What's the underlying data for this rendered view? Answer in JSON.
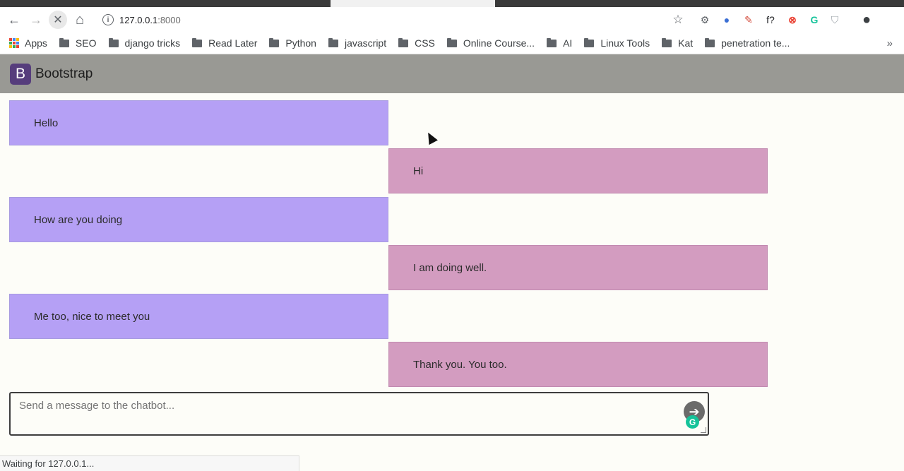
{
  "browser": {
    "url_host": "127.0.0.1",
    "url_port": ":8000",
    "nav": {
      "back": "←",
      "forward": "→",
      "stop": "✕",
      "home": "⌂"
    },
    "info_glyph": "i",
    "star_glyph": "☆",
    "extensions": [
      {
        "name": "puzzle-extension-icon",
        "glyph": "⚙",
        "color": "#5f6368"
      },
      {
        "name": "globe-extension-icon",
        "glyph": "●",
        "color": "#3b6fd4"
      },
      {
        "name": "eyedropper-extension-icon",
        "glyph": "✎",
        "color": "#d34a3a"
      },
      {
        "name": "function-extension-icon",
        "glyph": "f?",
        "color": "#202124"
      },
      {
        "name": "block-extension-icon",
        "glyph": "⊗",
        "color": "#ea4335"
      },
      {
        "name": "grammarly-extension-icon",
        "glyph": "G",
        "color": "#15c39a"
      },
      {
        "name": "shield-extension-icon",
        "glyph": "⛉",
        "color": "#9aa0a6"
      },
      {
        "name": "profile-avatar-icon",
        "glyph": "●",
        "color": "#3c4043"
      }
    ],
    "bookmarks": {
      "apps_label": "Apps",
      "folders": [
        "SEO",
        "django tricks",
        "Read Later",
        "Python",
        "javascript",
        "CSS",
        "Online Course...",
        "AI",
        "Linux Tools",
        "Kat",
        "penetration te..."
      ],
      "more_glyph": "»"
    },
    "status": "Waiting for 127.0.0.1..."
  },
  "app": {
    "brand_letter": "B",
    "brand_name": "Bootstrap",
    "colors": {
      "navbar": "#999994",
      "bot_bubble": "#b5a0f5",
      "user_bubble": "#d39cc0",
      "brand": "#563d7c"
    }
  },
  "chat": {
    "messages": [
      {
        "sender": "bot",
        "text": "Hello"
      },
      {
        "sender": "user",
        "text": "Hi"
      },
      {
        "sender": "bot",
        "text": "How are you doing"
      },
      {
        "sender": "user",
        "text": "I am doing well."
      },
      {
        "sender": "bot",
        "text": "Me too, nice to meet you"
      },
      {
        "sender": "user",
        "text": "Thank you. You too."
      }
    ],
    "input": {
      "placeholder": "Send a message to the chatbot...",
      "value": ""
    },
    "send_glyph": "➔",
    "grammarly_glyph": "G"
  }
}
